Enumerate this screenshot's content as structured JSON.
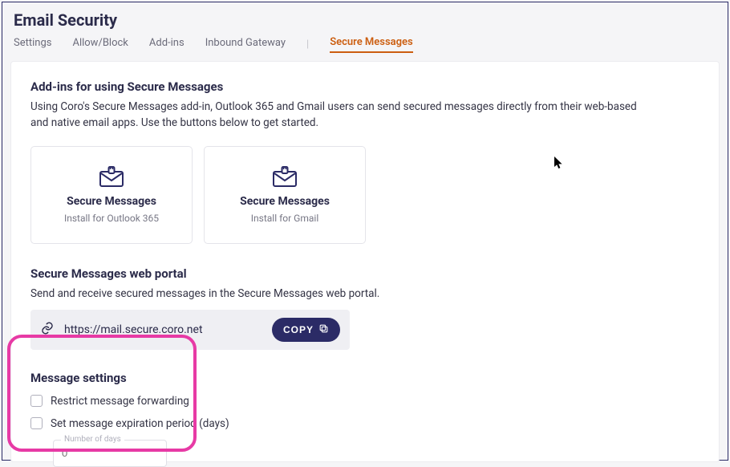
{
  "page": {
    "title": "Email Security"
  },
  "tabs": {
    "items": [
      "Settings",
      "Allow/Block",
      "Add-ins",
      "Inbound Gateway"
    ],
    "active": "Secure Messages",
    "sep": "|"
  },
  "addins": {
    "title": "Add-ins for using Secure Messages",
    "desc": "Using Coro's Secure Messages add-in, Outlook 365 and Gmail users can send secured messages directly from their web-based and native email apps. Use the buttons below to get started.",
    "cards": [
      {
        "title": "Secure Messages",
        "sub": "Install for Outlook 365"
      },
      {
        "title": "Secure Messages",
        "sub": "Install for Gmail"
      }
    ]
  },
  "portal": {
    "title": "Secure Messages web portal",
    "desc": "Send and receive secured messages in the Secure Messages web portal.",
    "url": "https://mail.secure.coro.net",
    "copy_label": "COPY"
  },
  "settings": {
    "title": "Message settings",
    "restrict": "Restrict message forwarding",
    "expire": "Set message expiration period (days)",
    "days_label": "Number of days",
    "days_placeholder": "0"
  }
}
